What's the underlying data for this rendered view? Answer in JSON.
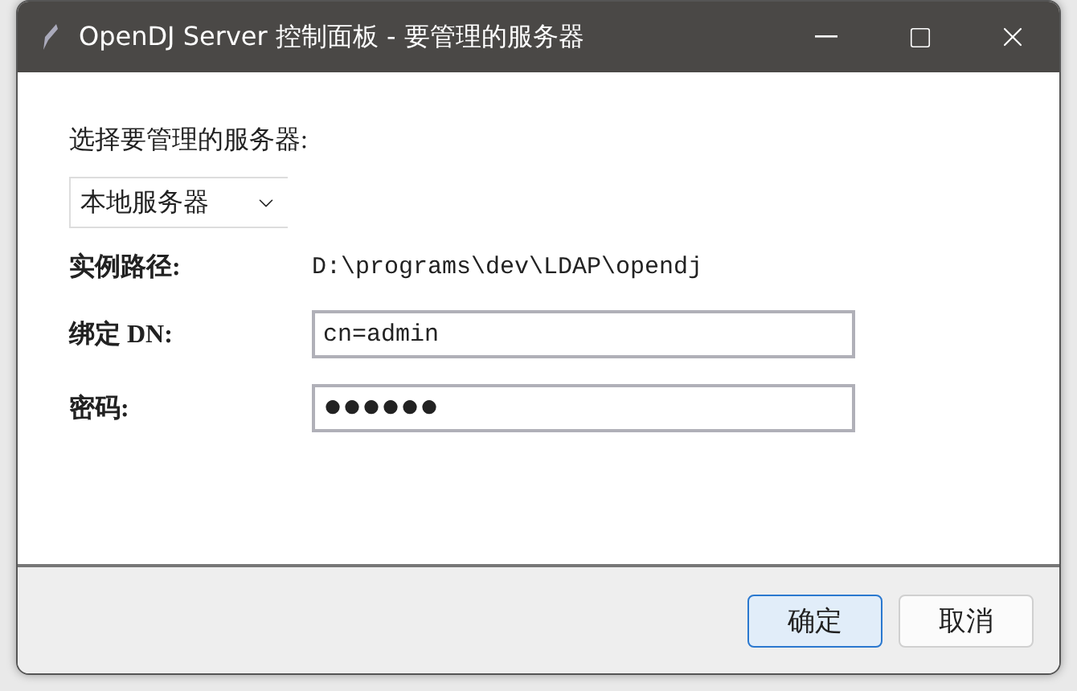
{
  "window": {
    "title": "OpenDJ Server 控制面板 - 要管理的服务器"
  },
  "prompt": "选择要管理的服务器:",
  "server_select": {
    "value": "本地服务器"
  },
  "fields": [
    {
      "label": "实例路径:",
      "kind": "text",
      "value": "D:\\programs\\dev\\LDAP\\opendj"
    },
    {
      "label": "绑定 DN:",
      "kind": "input",
      "value": "cn=admin"
    },
    {
      "label": "密码:",
      "kind": "password",
      "value": "●●●●●●"
    }
  ],
  "buttons": [
    {
      "label": "确定",
      "default": true
    },
    {
      "label": "取消",
      "default": false
    }
  ]
}
